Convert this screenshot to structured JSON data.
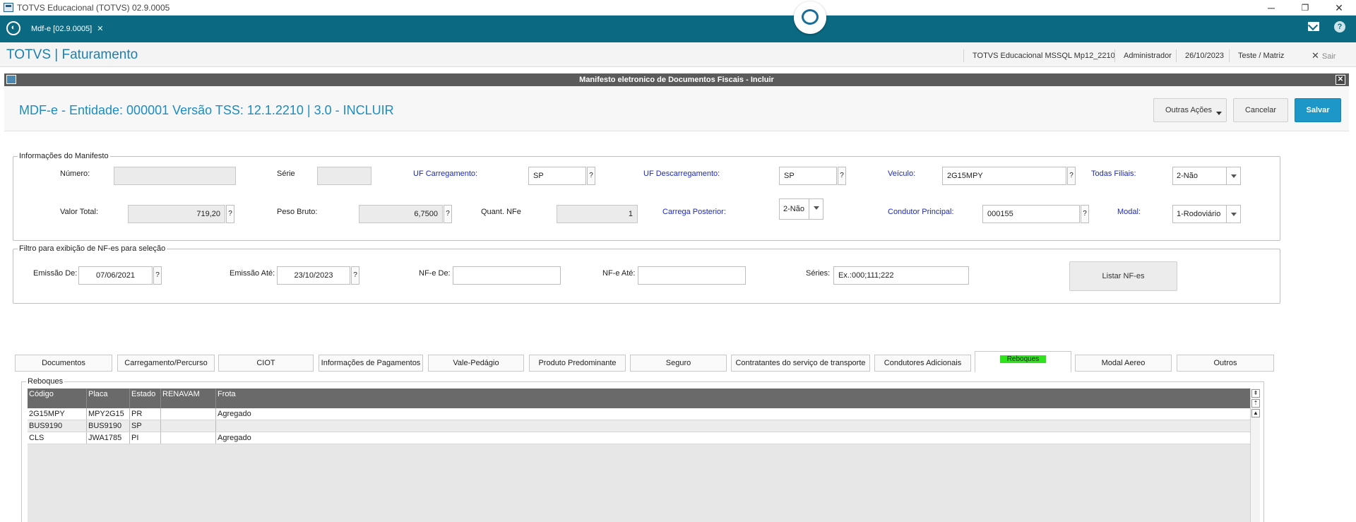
{
  "window": {
    "title": "TOTVS Educacional (TOTVS) 02.9.0005",
    "minimize": "─",
    "restore": "❐",
    "close": "✕"
  },
  "appbar": {
    "logo": "◐",
    "tab_label": "Mdf-e [02.9.0005]",
    "tab_close": "✕",
    "help": "?"
  },
  "module": {
    "title": "TOTVS | Faturamento",
    "environment": "TOTVS Educacional MSSQL Mp12_2210",
    "user": "Administrador",
    "date": "26/10/2023",
    "branch": "Teste / Matriz",
    "exit_label": "Sair",
    "exit_icon": "✕"
  },
  "dialog": {
    "title": "Manifesto eletronico de Documentos Fiscais - Incluir",
    "close": "✕",
    "heading": "MDF-e - Entidade: 000001 Versão TSS: 12.1.2210 | 3.0 - INCLUIR",
    "buttons": {
      "outras_acoes": "Outras Ações",
      "cancelar": "Cancelar",
      "salvar": "Salvar"
    }
  },
  "manifesto": {
    "legend": "Informações do Manifesto",
    "numero_label": "Número:",
    "numero_value": "",
    "serie_label": "Série",
    "serie_value": "",
    "uf_carregamento_label": "UF Carregamento:",
    "uf_carregamento_value": "SP",
    "uf_descarregamento_label": "UF Descarregamento:",
    "uf_descarregamento_value": "SP",
    "veiculo_label": "Veículo:",
    "veiculo_value": "2G15MPY",
    "todas_filiais_label": "Todas Filiais:",
    "todas_filiais_value": "2-Não",
    "valor_total_label": "Valor Total:",
    "valor_total_value": "719,20",
    "peso_bruto_label": "Peso Bruto:",
    "peso_bruto_value": "6,7500",
    "quant_nfe_label": "Quant. NFe",
    "quant_nfe_value": "1",
    "carrega_posterior_label": "Carrega Posterior:",
    "carrega_posterior_value": "2-Não",
    "condutor_label": "Condutor Principal:",
    "condutor_value": "000155",
    "modal_label": "Modal:",
    "modal_value": "1-Rodoviário",
    "lookup": "?"
  },
  "filtro": {
    "legend": "Filtro para exibição de NF-es para seleção",
    "emissao_de_label": "Emissão De:",
    "emissao_de_value": "07/06/2021",
    "emissao_ate_label": "Emissão Até:",
    "emissao_ate_value": "23/10/2023",
    "nfe_de_label": "NF-e De:",
    "nfe_de_value": "",
    "nfe_ate_label": "NF-e Até:",
    "nfe_ate_value": "",
    "series_label": "Séries:",
    "series_value": "Ex.:000;111;222",
    "listar_button": "Listar NF-es"
  },
  "tabs": [
    "Documentos",
    "Carregamento/Percurso",
    "CIOT",
    "Informações de Pagamentos",
    "Vale-Pedágio",
    "Produto Predominante",
    "Seguro",
    "Contratantes do serviço de transporte",
    "Condutores Adicionais",
    "Reboques",
    "Modal Aereo",
    "Outros"
  ],
  "active_tab": "Reboques",
  "active_tab_highlight": "#2ee31b",
  "reboques": {
    "legend": "Reboques",
    "columns": [
      "Código",
      "Placa",
      "Estado",
      "RENAVAM",
      "Frota"
    ],
    "rows": [
      [
        "2G15MPY",
        "MPY2G15",
        "PR",
        "",
        "Agregado"
      ],
      [
        "BUS9190",
        "BUS9190",
        "SP",
        "",
        ""
      ],
      [
        "CLS",
        "JWA1785",
        "PI",
        "",
        "Agregado"
      ]
    ],
    "scroll_top": "⇞",
    "scroll_pgup": "⇡",
    "scroll_up": "▲"
  },
  "colors": {
    "appbar": "#0b6a82",
    "accent": "#1d8cbf",
    "save_button": "#1d97c8",
    "label_blue": "#1b28c9"
  }
}
